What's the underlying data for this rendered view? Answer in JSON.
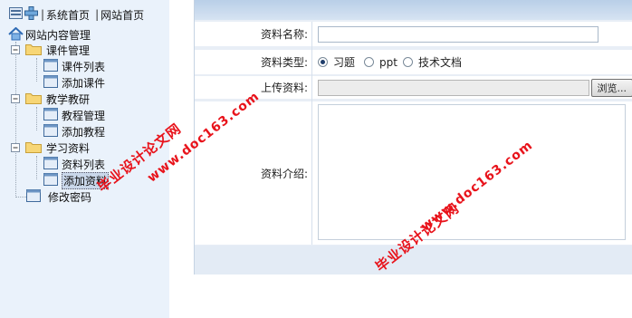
{
  "toplinks": {
    "home": "系统首页",
    "site_home": "网站首页",
    "separator": "|"
  },
  "tree": {
    "root": "网站内容管理",
    "folders": [
      {
        "label": "课件管理",
        "items": [
          "课件列表",
          "添加课件"
        ]
      },
      {
        "label": "教学教研",
        "items": [
          "教程管理",
          "添加教程"
        ]
      },
      {
        "label": "学习资料",
        "items": [
          "资料列表",
          "添加资料"
        ]
      }
    ],
    "extra": "修改密码",
    "selected": "添加资料"
  },
  "form": {
    "name_label": "资料名称:",
    "type_label": "资料类型:",
    "type_options": [
      {
        "label": "习题",
        "checked": true
      },
      {
        "label": "ppt",
        "checked": false
      },
      {
        "label": "技术文档",
        "checked": false
      }
    ],
    "upload_label": "上传资料:",
    "browse_label": "浏览...",
    "intro_label": "资料介绍:"
  },
  "watermark": {
    "line1": "毕业设计论文网",
    "line2": "www.doc163.com",
    "color": "#e8131b"
  },
  "colors": {
    "sidebar_bg": "#eaf2fb",
    "form_bg": "#e8eef6",
    "header_bar": "#c6d9ef"
  }
}
